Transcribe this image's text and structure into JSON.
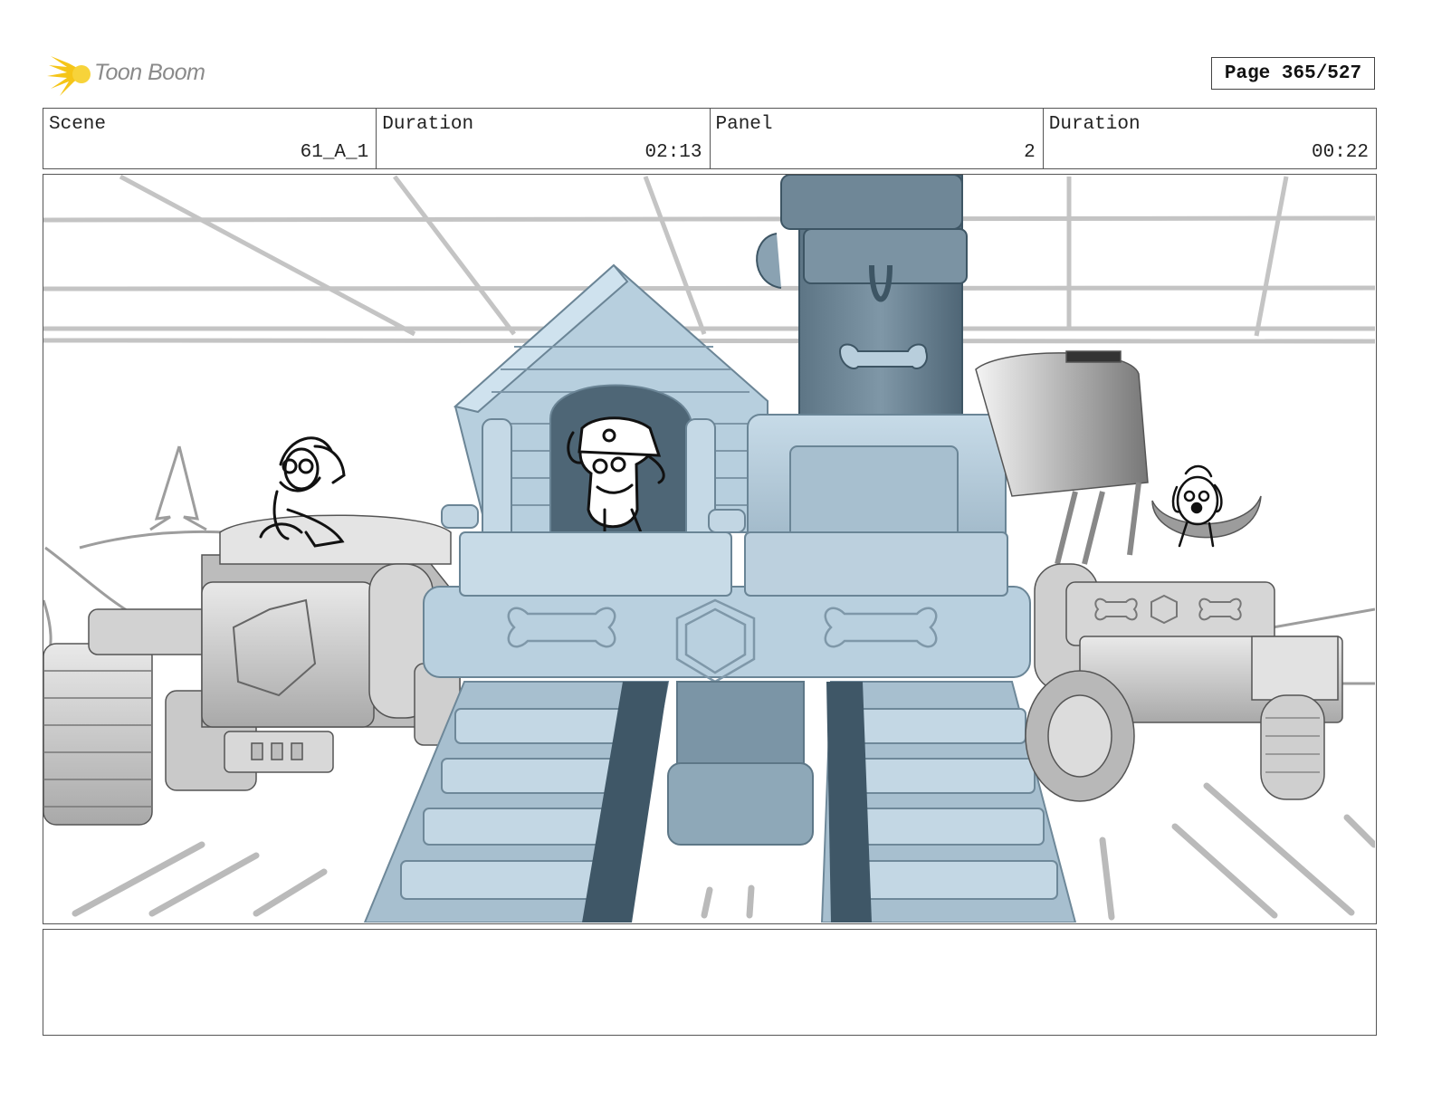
{
  "brand": {
    "name": "Toon Boom",
    "star_color": "#F5C518"
  },
  "page": {
    "label": "Page 365/527"
  },
  "fields": [
    {
      "label": "Scene",
      "value": "61_A_1"
    },
    {
      "label": "Duration",
      "value": "02:13"
    },
    {
      "label": "Panel",
      "value": "2"
    },
    {
      "label": "Duration",
      "value": "00:22"
    }
  ],
  "panel_image": {
    "icon": "storyboard-panel-illustration"
  },
  "notes": {
    "text": ""
  }
}
